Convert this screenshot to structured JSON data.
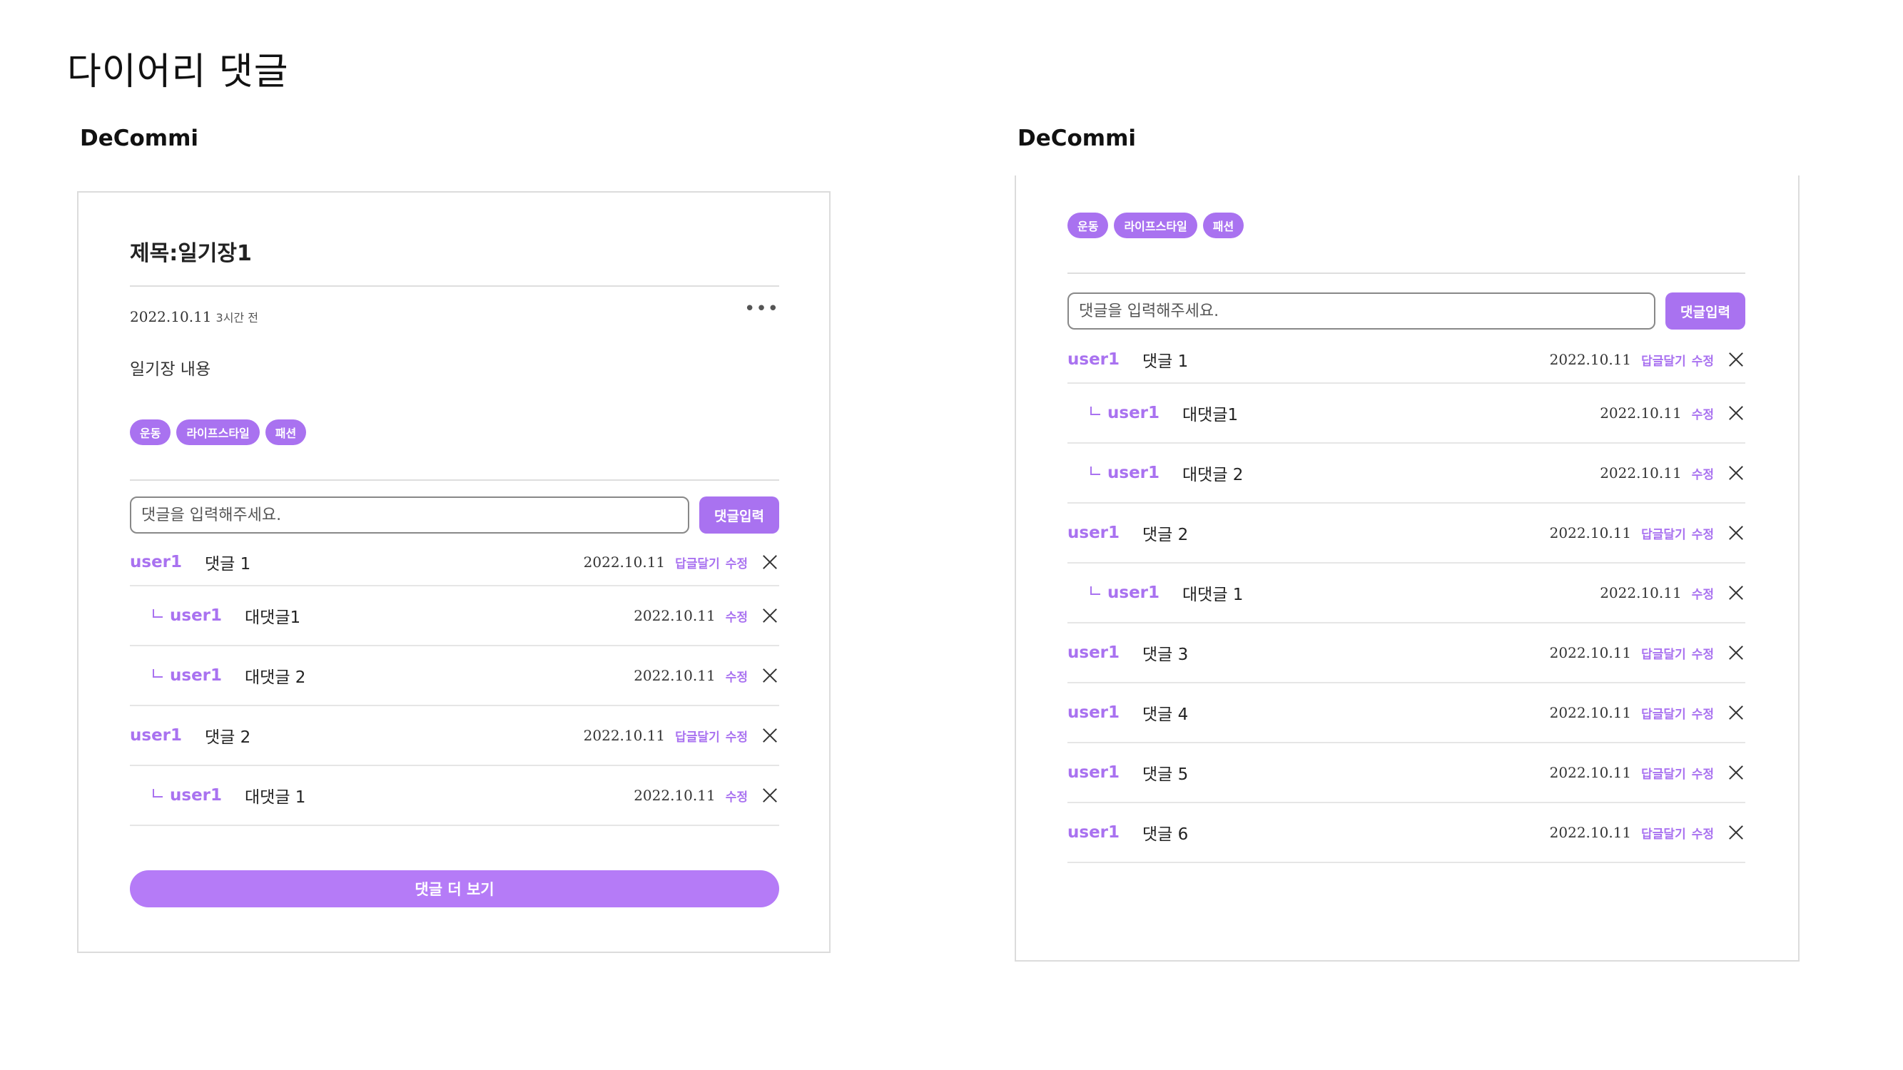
{
  "page_title": "다이어리 댓글",
  "left": {
    "brand": "DeCommi",
    "post": {
      "title": "제목:일기장1",
      "date": "2022.10.11",
      "ago": "3시간 전",
      "more": "•••",
      "body": "일기장 내용"
    },
    "tags": [
      "운동",
      "라이프스타일",
      "패션"
    ],
    "input": {
      "placeholder": "댓글을 입력해주세요.",
      "submit": "댓글입력"
    },
    "comments": [
      {
        "user": "user1",
        "text": "댓글 1",
        "date": "2022.10.11",
        "reply_label": "답글달기",
        "edit_label": "수정"
      },
      {
        "user": "user1",
        "text": "대댓글1",
        "date": "2022.10.11",
        "edit_label": "수정"
      },
      {
        "user": "user1",
        "text": "대댓글 2",
        "date": "2022.10.11",
        "edit_label": "수정"
      },
      {
        "user": "user1",
        "text": "댓글 2",
        "date": "2022.10.11",
        "reply_label": "답글달기",
        "edit_label": "수정"
      },
      {
        "user": "user1",
        "text": "대댓글 1",
        "date": "2022.10.11",
        "edit_label": "수정"
      }
    ],
    "more_button": "댓글 더 보기"
  },
  "right": {
    "brand": "DeCommi",
    "tags": [
      "운동",
      "라이프스타일",
      "패션"
    ],
    "input": {
      "placeholder": "댓글을 입력해주세요.",
      "submit": "댓글입력"
    },
    "comments": [
      {
        "user": "user1",
        "text": "댓글 1",
        "date": "2022.10.11",
        "reply_label": "답글달기",
        "edit_label": "수정"
      },
      {
        "user": "user1",
        "text": "대댓글1",
        "date": "2022.10.11",
        "edit_label": "수정"
      },
      {
        "user": "user1",
        "text": "대댓글 2",
        "date": "2022.10.11",
        "edit_label": "수정"
      },
      {
        "user": "user1",
        "text": "댓글 2",
        "date": "2022.10.11",
        "reply_label": "답글달기",
        "edit_label": "수정"
      },
      {
        "user": "user1",
        "text": "대댓글 1",
        "date": "2022.10.11",
        "edit_label": "수정"
      },
      {
        "user": "user1",
        "text": "댓글 3",
        "date": "2022.10.11",
        "reply_label": "답글달기",
        "edit_label": "수정"
      },
      {
        "user": "user1",
        "text": "댓글 4",
        "date": "2022.10.11",
        "reply_label": "답글달기",
        "edit_label": "수정"
      },
      {
        "user": "user1",
        "text": "댓글 5",
        "date": "2022.10.11",
        "reply_label": "답글달기",
        "edit_label": "수정"
      },
      {
        "user": "user1",
        "text": "댓글 6",
        "date": "2022.10.11",
        "reply_label": "답글달기",
        "edit_label": "수정"
      }
    ]
  },
  "colors": {
    "accent": "#a972f0",
    "more_button": "#b57bf7",
    "border": "#dcdcdc"
  },
  "icons": {
    "delete": "close-icon",
    "reply_marker": "reply-corner-icon",
    "menu": "more-dots-icon"
  }
}
